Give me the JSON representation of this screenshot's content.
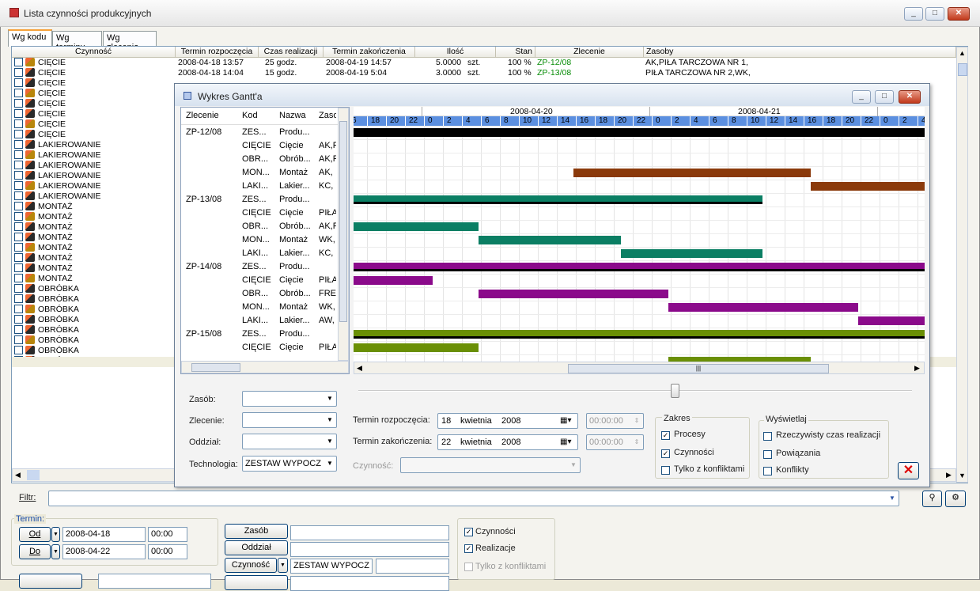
{
  "window": {
    "title": "Lista czynności produkcyjnych"
  },
  "tabs": [
    "Wg kodu",
    "Wg terminu",
    "Wg zlecenia"
  ],
  "columns": [
    "Czynność",
    "Termin rozpoczęcia",
    "Czas realizacji",
    "Termin zakończenia",
    "Ilość",
    "Stan",
    "Zlecenie",
    "Zasoby"
  ],
  "rows": [
    {
      "name": "CIĘCIE",
      "start": "2008-04-18 13:57",
      "dur": "25 godz.",
      "end": "2008-04-19 14:57",
      "qty": "5.0000",
      "unit": "szt.",
      "stan": "100 %",
      "order": "ZP-12/08",
      "res": "AK,PIŁA TARCZOWA NR 1,"
    },
    {
      "name": "CIĘCIE",
      "start": "2008-04-18 14:04",
      "dur": "15 godz.",
      "end": "2008-04-19 5:04",
      "qty": "3.0000",
      "unit": "szt.",
      "stan": "100 %",
      "order": "ZP-13/08",
      "res": "PIŁA TARCZOWA NR 2,WK,"
    },
    {
      "name": "CIĘCIE"
    },
    {
      "name": "CIĘCIE"
    },
    {
      "name": "CIĘCIE"
    },
    {
      "name": "CIĘCIE"
    },
    {
      "name": "CIĘCIE"
    },
    {
      "name": "CIĘCIE"
    },
    {
      "name": "LAKIEROWANIE"
    },
    {
      "name": "LAKIEROWANIE"
    },
    {
      "name": "LAKIEROWANIE"
    },
    {
      "name": "LAKIEROWANIE"
    },
    {
      "name": "LAKIEROWANIE"
    },
    {
      "name": "LAKIEROWANIE"
    },
    {
      "name": "MONTAŻ"
    },
    {
      "name": "MONTAŻ"
    },
    {
      "name": "MONTAŻ"
    },
    {
      "name": "MONTAŻ"
    },
    {
      "name": "MONTAŻ"
    },
    {
      "name": "MONTAŻ"
    },
    {
      "name": "MONTAŻ"
    },
    {
      "name": "MONTAŻ"
    },
    {
      "name": "OBRÓBKA"
    },
    {
      "name": "OBRÓBKA"
    },
    {
      "name": "OBRÓBKA"
    },
    {
      "name": "OBRÓBKA"
    },
    {
      "name": "OBRÓBKA"
    },
    {
      "name": "OBRÓBKA"
    },
    {
      "name": "OBRÓBKA"
    },
    {
      "name": "OBRÓBKA"
    }
  ],
  "gantt": {
    "title": "Wykres Gantt'a",
    "cols": [
      "Zlecenie",
      "Kod",
      "Nazwa",
      "Zaso"
    ],
    "rows": [
      [
        "ZP-12/08",
        "ZES...",
        "Produ...",
        ""
      ],
      [
        "",
        "CIĘCIE",
        "Cięcie",
        "AK,F"
      ],
      [
        "",
        "OBR...",
        "Obrób...",
        "AK,F"
      ],
      [
        "",
        "MON...",
        "Montaż",
        "AK,"
      ],
      [
        "",
        "LAKI...",
        "Lakier...",
        "KC,"
      ],
      [
        "ZP-13/08",
        "ZES...",
        "Produ...",
        ""
      ],
      [
        "",
        "CIĘCIE",
        "Cięcie",
        "PIŁA"
      ],
      [
        "",
        "OBR...",
        "Obrób...",
        "AK,F"
      ],
      [
        "",
        "MON...",
        "Montaż",
        "WK,"
      ],
      [
        "",
        "LAKI...",
        "Lakier...",
        "KC,"
      ],
      [
        "ZP-14/08",
        "ZES...",
        "Produ...",
        ""
      ],
      [
        "",
        "CIĘCIE",
        "Cięcie",
        "PIŁA"
      ],
      [
        "",
        "OBR...",
        "Obrób...",
        "FRE."
      ],
      [
        "",
        "MON...",
        "Montaż",
        "WK,"
      ],
      [
        "",
        "LAKI...",
        "Lakier...",
        "AW,"
      ],
      [
        "ZP-15/08",
        "ZES...",
        "Produ...",
        ""
      ],
      [
        "",
        "CIĘCIE",
        "Cięcie",
        "PIŁA"
      ]
    ],
    "dates": [
      "2008-04-20",
      "2008-04-21"
    ],
    "hours": [
      "6",
      "18",
      "20",
      "22",
      "0",
      "2",
      "4",
      "6",
      "8",
      "10",
      "12",
      "14",
      "16",
      "18",
      "20",
      "22",
      "0",
      "2",
      "4",
      "6",
      "8",
      "10",
      "12",
      "14",
      "16",
      "18",
      "20",
      "22",
      "0",
      "2",
      "4"
    ],
    "labels": {
      "zasob": "Zasób:",
      "zlecenie": "Zlecenie:",
      "oddzial": "Oddział:",
      "technologia": "Technologia:",
      "technologia_val": "ZESTAW WYPOCZ",
      "start": "Termin rozpoczęcia:",
      "end": "Termin zakończenia:",
      "czynnosc": "Czynność:"
    },
    "start_date": {
      "day": "18",
      "month": "kwietnia",
      "year": "2008",
      "time": "00:00:00"
    },
    "end_date": {
      "day": "22",
      "month": "kwietnia",
      "year": "2008",
      "time": "00:00:00"
    },
    "zakres": {
      "title": "Zakres",
      "procesy": "Procesy",
      "czynnosci": "Czynności",
      "konflikty": "Tylko z konfliktami"
    },
    "wyswietlaj": {
      "title": "Wyświetlaj",
      "rzecz": "Rzeczywisty czas realizacji",
      "powiazania": "Powiązania",
      "konflikty": "Konflikty"
    }
  },
  "filter": {
    "label": "Filtr:"
  },
  "termin": {
    "label": "Termin:",
    "od": "Od",
    "do": "Do",
    "od_date": "2008-04-18",
    "do_date": "2008-04-22",
    "od_time": "00:00",
    "do_time": "00:00"
  },
  "buttons": {
    "zasob": "Zasób",
    "oddzial": "Oddział",
    "czynnosc": "Czynność",
    "czynnosc_val": "ZESTAW WYPOCZ"
  },
  "checks": {
    "czynnosci": "Czynności",
    "realizacje": "Realizacje",
    "konflikty": "Tylko z konfliktami"
  },
  "colors": {
    "black": "#000000",
    "brown": "#8b3a0b",
    "teal": "#0b7f64",
    "purple": "#8b0a8b",
    "olive": "#6a8f05"
  }
}
